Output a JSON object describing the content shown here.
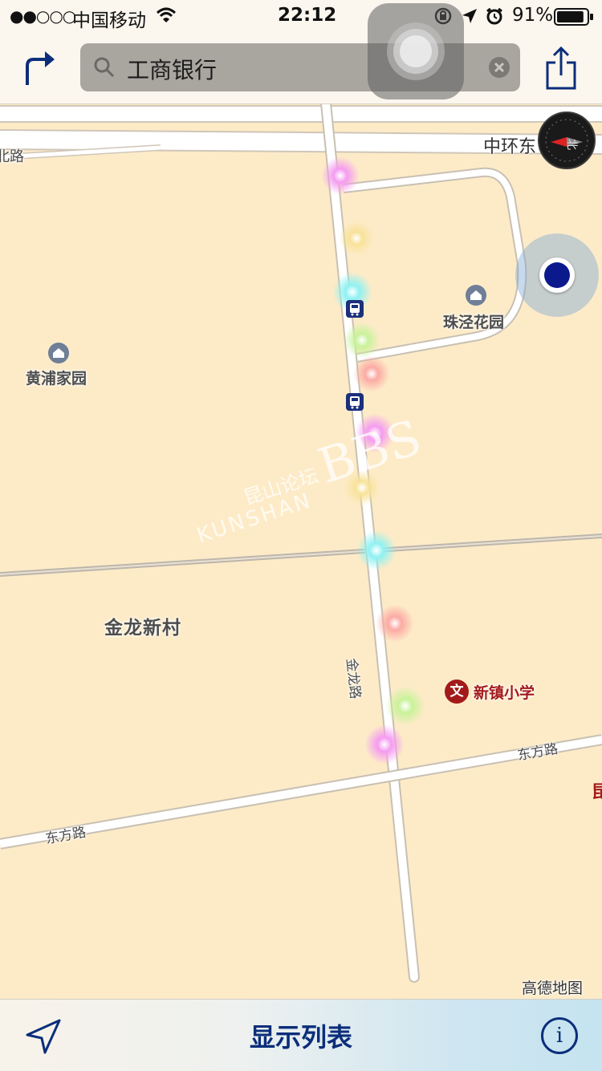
{
  "status_bar": {
    "signal": "●●○○○",
    "carrier": "中国移动",
    "time": "22:12",
    "battery_percent": "91%",
    "battery_level": 0.91
  },
  "nav_bar": {
    "search_value": "工商银行"
  },
  "map": {
    "labels": {
      "ring_road": "中环东",
      "left_road": "北路",
      "huangpu": "黄浦家园",
      "zhujing": "珠泾花园",
      "jinlong_village": "金龙新村",
      "jinlong_road": "金龙路",
      "xinzhen_school": "新镇小学",
      "dongfang_right": "东方路",
      "dongfang_left": "东方路",
      "edge_char": "昆",
      "watermark_cn": "昆山论坛",
      "watermark_en": "KUNSHAN",
      "watermark_bbs": "BBS",
      "attribution": "高德地图"
    },
    "school_icon_glyph": "文",
    "colors": {
      "land": "#fdebc8",
      "road": "#ffffff",
      "location_blue": "#0a1a8c",
      "school_red": "#a31a1a",
      "accent": "#0b2e7a"
    }
  },
  "toolbar": {
    "show_list_label": "显示列表",
    "info_glyph": "i"
  }
}
